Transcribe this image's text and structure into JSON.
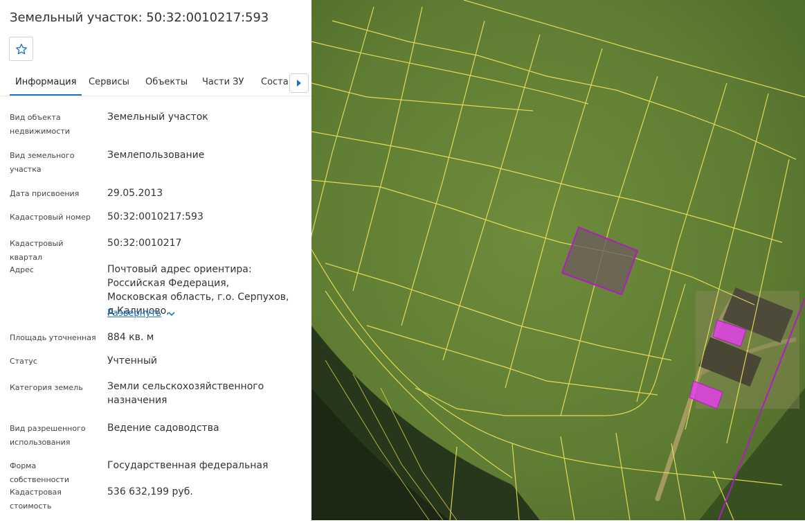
{
  "title": "Земельный участок: 50:32:0010217:593",
  "tabs": [
    {
      "label": "Информация",
      "active": true
    },
    {
      "label": "Сервисы"
    },
    {
      "label": "Объекты"
    },
    {
      "label": "Части ЗУ"
    },
    {
      "label": "Состав"
    }
  ],
  "fields": [
    {
      "label": "Вид объекта недвижимости",
      "value": "Земельный участок"
    },
    {
      "label": "Вид земельного участка",
      "value": "Землепользование"
    },
    {
      "label": "Дата присвоения",
      "value": "29.05.2013"
    },
    {
      "label": "Кадастровый номер",
      "value": "50:32:0010217:593"
    },
    {
      "label": "Кадастровый квартал",
      "value": "50:32:0010217"
    },
    {
      "label": "Адрес",
      "value": "Почтовый адрес ориентира: Российская Федерация, Московская область, г.о. Серпухов, д Калиново,"
    },
    {
      "label": "Площадь уточненная",
      "value": "884 кв. м"
    },
    {
      "label": "Статус",
      "value": "Учтенный"
    },
    {
      "label": "Категория земель",
      "value": "Земли сельскохозяйственного назначения"
    },
    {
      "label": "Вид разрешенного использования",
      "value": "Ведение садоводства"
    },
    {
      "label": "Форма собственности",
      "value": "Государственная федеральная"
    },
    {
      "label": "Кадастровая стоимость",
      "value": "536 632,199 руб."
    }
  ],
  "address_expand_label": "Развернуть",
  "icons": {
    "favorite": "star-outline-icon",
    "tabs_next": "triangle-right-icon",
    "expand": "chevron-down-icon"
  },
  "colors": {
    "accent": "#1a73c4",
    "parcel_boundary": "#f2e35c",
    "selected_parcel": "#b01cc0",
    "building": "#e040e8"
  }
}
